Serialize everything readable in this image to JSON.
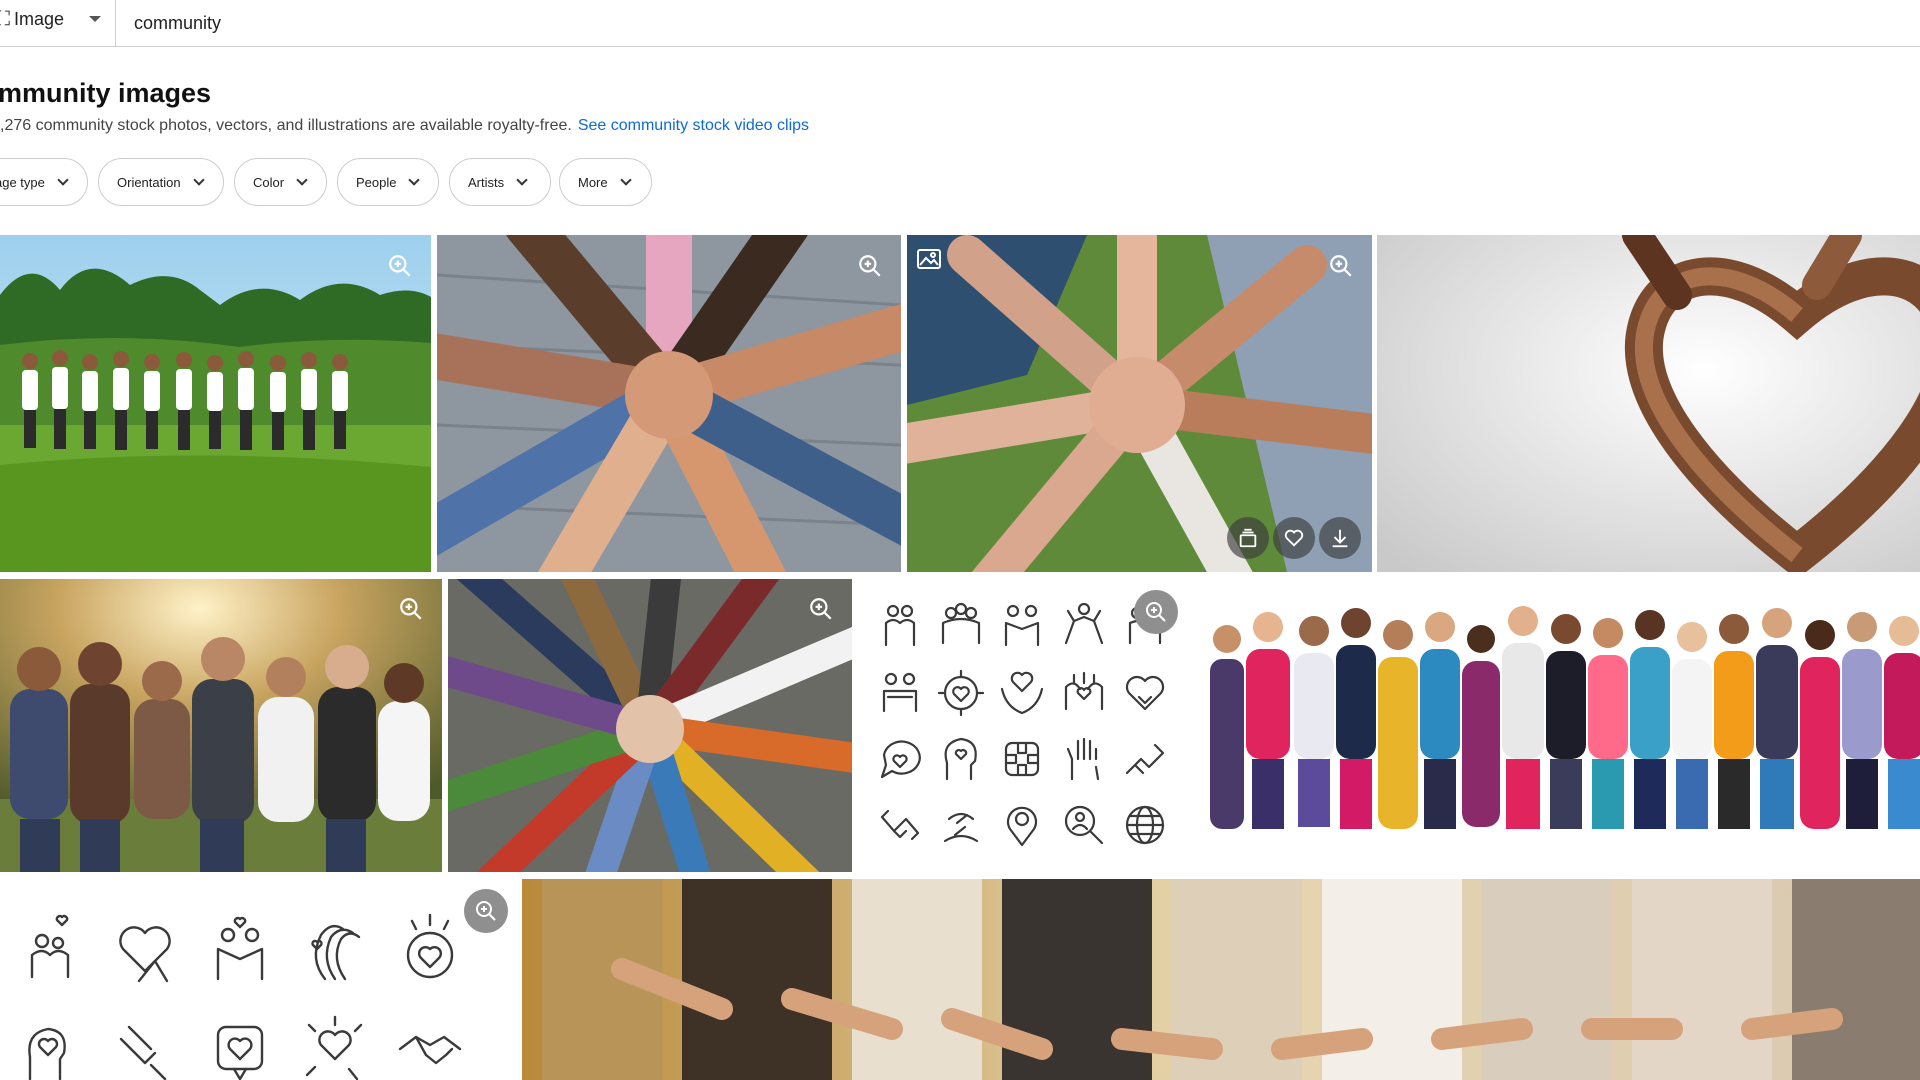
{
  "search": {
    "type_label": "Image",
    "type_glyph": "⛶",
    "query": "community"
  },
  "header": {
    "title": "mmunity images",
    "summary_text": ",276 community stock photos, vectors, and illustrations are available royalty-free.",
    "video_link": "See community stock video clips"
  },
  "filters": [
    {
      "label": "age type"
    },
    {
      "label": "Orientation"
    },
    {
      "label": "Color"
    },
    {
      "label": "People"
    },
    {
      "label": "Artists"
    },
    {
      "label": "More"
    }
  ],
  "icons": {
    "zoom": "zoom-in-icon",
    "collection": "add-to-collection-icon",
    "favorite": "heart-icon",
    "download": "download-icon",
    "image_badge": "image-icon"
  },
  "colors": {
    "link": "#0d6ad8",
    "chip_border": "#cdcdcd",
    "divider": "#cfcfcf"
  }
}
